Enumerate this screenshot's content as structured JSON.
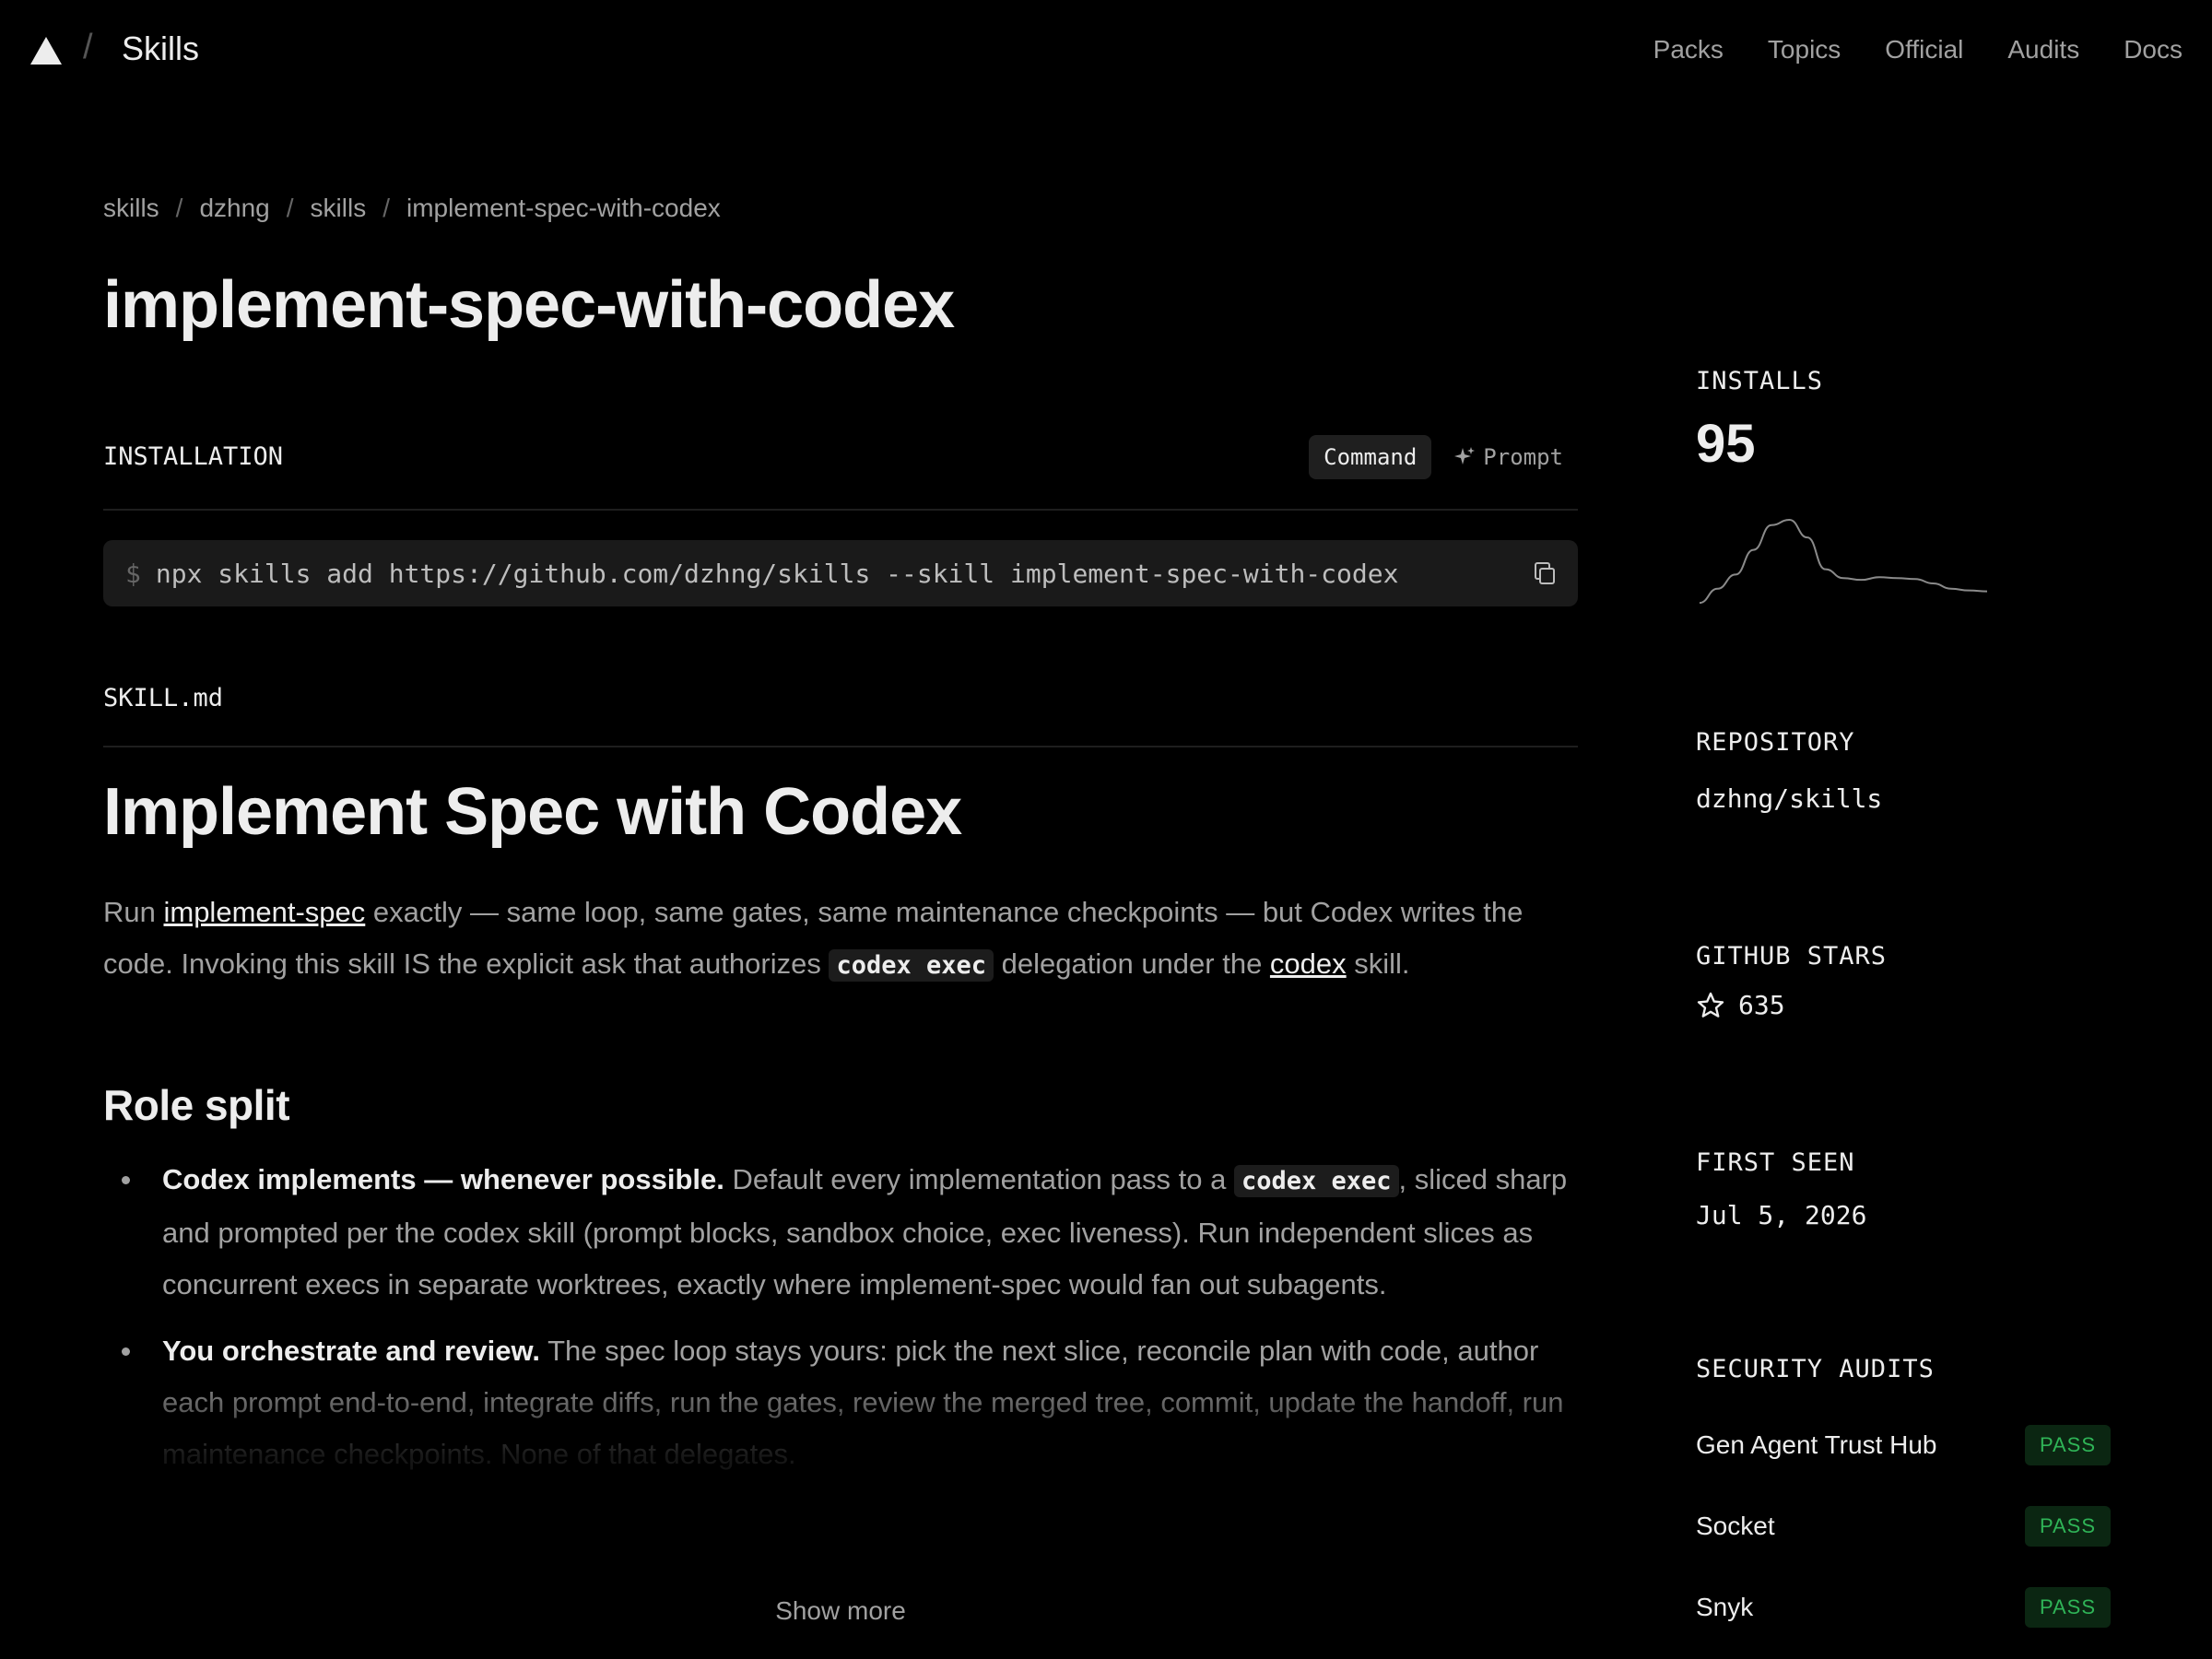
{
  "nav": {
    "brand": "Skills",
    "links": [
      "Packs",
      "Topics",
      "Official",
      "Audits",
      "Docs"
    ]
  },
  "breadcrumb": [
    "skills",
    "dzhng",
    "skills",
    "implement-spec-with-codex"
  ],
  "page_title": "implement-spec-with-codex",
  "installation": {
    "label": "INSTALLATION",
    "tabs": {
      "command": "Command",
      "prompt": "Prompt",
      "active": "Command"
    },
    "prompt_symbol": "$",
    "command": "npx skills add https://github.com/dzhng/skills --skill implement-spec-with-codex"
  },
  "skill_md": {
    "label": "SKILL.md",
    "h1": "Implement Spec with Codex",
    "intro": {
      "t1": "Run ",
      "link1": "implement-spec",
      "t2": " exactly — same loop, same gates, same maintenance checkpoints — but Codex writes the code. Invoking this skill IS the explicit ask that authorizes ",
      "code": "codex exec",
      "t3": " delegation under the ",
      "link2": "codex",
      "t4": " skill."
    },
    "h2": "Role split",
    "items": [
      {
        "bold": "Codex implements — whenever possible.",
        "t1": " Default every implementation pass to a ",
        "code": "codex exec",
        "t2": ", sliced sharp and prompted per the codex skill (prompt blocks, sandbox choice, exec liveness). Run independent slices as concurrent execs in separate worktrees, exactly where implement-spec would fan out subagents."
      },
      {
        "bold": "You orchestrate and review.",
        "t1": " The spec loop stays yours: pick the next slice, reconcile plan with code, author each prompt end-to-end, integrate diffs, run the gates, review the merged tree, commit, update the handoff, run maintenance checkpoints. None of that delegates."
      }
    ],
    "show_more": "Show more"
  },
  "sidebar": {
    "installs_label": "INSTALLS",
    "installs": "95",
    "installs_trend": [
      2,
      18,
      34,
      62,
      90,
      96,
      76,
      40,
      30,
      28,
      31,
      30,
      29,
      24,
      18,
      16,
      15
    ],
    "repository_label": "REPOSITORY",
    "repository": "dzhng/skills",
    "stars_label": "GITHUB STARS",
    "stars": "635",
    "first_seen_label": "FIRST SEEN",
    "first_seen": "Jul 5, 2026",
    "audits_label": "SECURITY AUDITS",
    "audits": [
      {
        "name": "Gen Agent Trust Hub",
        "status": "PASS"
      },
      {
        "name": "Socket",
        "status": "PASS"
      },
      {
        "name": "Snyk",
        "status": "PASS"
      }
    ]
  },
  "colors": {
    "background": "#000000",
    "text": "#ededed",
    "muted": "#a1a1a1",
    "pass_bg": "#0b2612",
    "pass_text": "#2fb457"
  }
}
